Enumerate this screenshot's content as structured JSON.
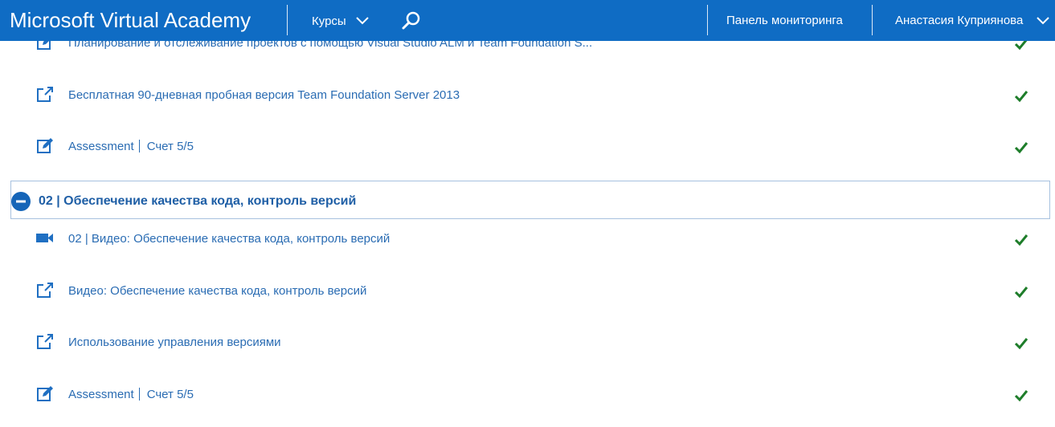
{
  "header": {
    "brand": "Microsoft Virtual Academy",
    "courses_label": "Курсы",
    "dashboard_label": "Панель мониторинга",
    "user_name": "Анастасия Куприянова"
  },
  "items_top": [
    {
      "icon": "edit-icon",
      "title": "Планирование и отслеживание проектов с помощью Visual Studio ALM и Team Foundation S...",
      "status": "completed"
    },
    {
      "icon": "external-link-icon",
      "title": "Бесплатная 90-дневная пробная версия Team Foundation Server 2013",
      "status": "completed"
    },
    {
      "icon": "assessment-icon",
      "title": "Assessment",
      "score": "Счет 5/5",
      "status": "completed"
    }
  ],
  "section": {
    "title": "02 | Обеспечение качества кода, контроль версий",
    "state": "expanded"
  },
  "items_section": [
    {
      "icon": "video-icon",
      "title": "02 | Видео: Обеспечение качества кода, контроль версий",
      "status": "completed"
    },
    {
      "icon": "external-link-icon",
      "title": "Видео: Обеспечение качества кода, контроль версий",
      "status": "completed"
    },
    {
      "icon": "external-link-icon",
      "title": "Использование управления версиями",
      "status": "completed"
    },
    {
      "icon": "assessment-icon",
      "title": "Assessment",
      "score": "Счет 5/5",
      "status": "completed"
    }
  ],
  "colors": {
    "header_bg": "#0f6cc4",
    "link": "#2a6cb3",
    "check": "#1e7d2a"
  }
}
